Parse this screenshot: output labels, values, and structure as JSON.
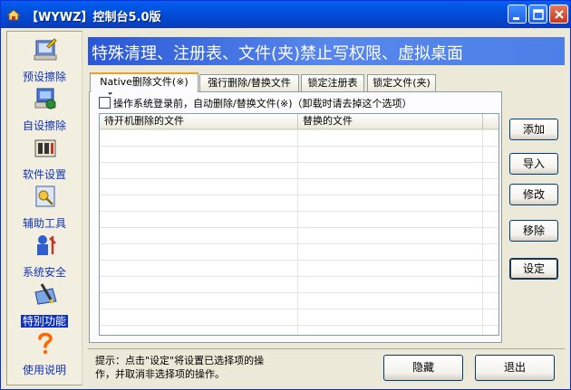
{
  "window": {
    "title": "【WYWZ】控制台5.0版",
    "accent_color": "#0058e6",
    "controls": [
      "minimize-icon",
      "maximize-icon",
      "close-icon"
    ]
  },
  "sidebar": {
    "items": [
      {
        "label": "预设擦除",
        "icon": "preset-erase-icon"
      },
      {
        "label": "自设擦除",
        "icon": "custom-erase-icon"
      },
      {
        "label": "软件设置",
        "icon": "software-settings-icon"
      },
      {
        "label": "辅助工具",
        "icon": "tools-icon"
      },
      {
        "label": "系统安全",
        "icon": "system-security-icon"
      },
      {
        "label": "特别功能",
        "icon": "special-function-icon",
        "active": true
      },
      {
        "label": "使用说明",
        "icon": "help-icon"
      }
    ]
  },
  "header": {
    "title": "特殊清理、注册表、文件(夹)禁止写权限、虚拟桌面"
  },
  "tabs": [
    {
      "label": "Native删除文件(※)",
      "active": true
    },
    {
      "label": "强行删除/替换文件"
    },
    {
      "label": "锁定注册表"
    },
    {
      "label": "锁定文件(夹)"
    }
  ],
  "option": {
    "label": "操作系统登录前，自动删除/替换文件(※)（卸载时请去掉这个选项）",
    "checked": false
  },
  "list": {
    "columns": [
      "待开机删除的文件",
      "替换的文件"
    ],
    "rows": []
  },
  "side_buttons": {
    "add": "添加",
    "import": "导入",
    "modify": "修改",
    "remove": "移除",
    "settings": "设定"
  },
  "footer": {
    "hint_line1": "提示：点击\"设定\"将设置已选择项的操",
    "hint_line2": "作，并取消非选择项的操作。",
    "hide": "隐藏",
    "exit": "退出"
  }
}
